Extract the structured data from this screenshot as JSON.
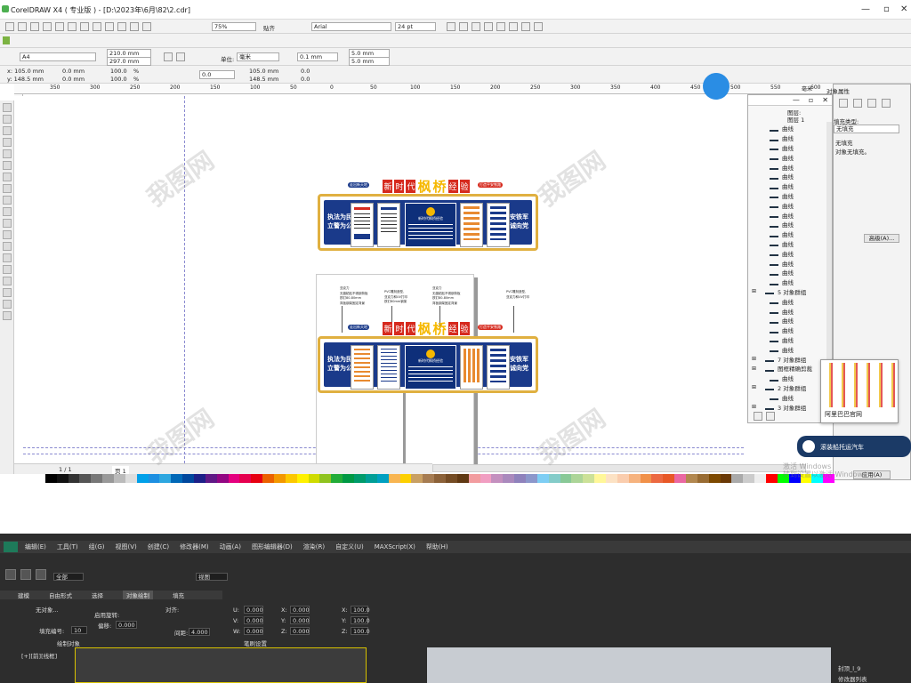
{
  "window": {
    "title": "CorelDRAW X4 ( 专业版 ) - [D:\\2023年\\6月\\82\\2.cdr]"
  },
  "toolbar1": {
    "zoom": "75%",
    "snap": "贴齐",
    "font": "Arial",
    "font_size": "24 pt"
  },
  "propbar": {
    "page_size": "A4",
    "width": "210.0 mm",
    "height": "297.0 mm",
    "unit_label": "单位:",
    "unit": "毫米",
    "nudge": "0.1 mm",
    "dup_x": "5.0 mm",
    "dup_y": "5.0 mm"
  },
  "objbar": {
    "x": "105.0 mm",
    "y": "148.5 mm",
    "w": "0.0 mm",
    "h": "0.0 mm",
    "sx": "100.0",
    "sy": "100.0",
    "pct": "%",
    "rot": "0.0",
    "cx": "105.0 mm",
    "cy": "148.5 mm",
    "o1": "0.0",
    "o2": "0.0"
  },
  "ruler": {
    "ticks": [
      "350",
      "300",
      "250",
      "200",
      "150",
      "100",
      "50",
      "0",
      "50",
      "100",
      "150",
      "200",
      "250",
      "300",
      "350",
      "400",
      "450",
      "500",
      "550",
      "600",
      "650"
    ],
    "unit": "毫米"
  },
  "board": {
    "title_parts": [
      "新",
      "时",
      "代",
      "枫",
      "桥",
      "经",
      "验"
    ],
    "left_text": [
      "执法为民",
      "立警为公"
    ],
    "right_text": [
      "公安铁军",
      "忠诚向党"
    ],
    "center_title": "新时代枫桥经验",
    "tag_left": "走出新天地",
    "tag_right": "打造平安铁路",
    "callouts": [
      "亚克力\n无缝粘贴不锈钢背板\n铁钉80-80mm\n背板钢架固定背景",
      "PVC雕刻造型,\n亚克力和UV打印\n铁钉80mm钢架",
      "亚克力\n无缝粘贴不锈钢背板\n铁钉80-80mm\n背板钢架固定背景",
      "PVC雕刻造型,\n亚克力和UV打印"
    ]
  },
  "objects_panel": {
    "layer1": "图层:",
    "layer2": "图层 1",
    "items": [
      {
        "label": "曲线"
      },
      {
        "label": "曲线"
      },
      {
        "label": "曲线"
      },
      {
        "label": "曲线"
      },
      {
        "label": "曲线"
      },
      {
        "label": "曲线"
      },
      {
        "label": "曲线"
      },
      {
        "label": "曲线"
      },
      {
        "label": "曲线"
      },
      {
        "label": "曲线"
      },
      {
        "label": "曲线"
      },
      {
        "label": "曲线"
      },
      {
        "label": "曲线"
      },
      {
        "label": "曲线"
      },
      {
        "label": "曲线"
      },
      {
        "label": "曲线"
      },
      {
        "label": "曲线"
      },
      {
        "label": "5 对象群组",
        "group": true
      },
      {
        "label": "曲线"
      },
      {
        "label": "曲线"
      },
      {
        "label": "曲线"
      },
      {
        "label": "曲线"
      },
      {
        "label": "曲线"
      },
      {
        "label": "曲线"
      },
      {
        "label": "7 对象群组",
        "group": true
      },
      {
        "label": "图框精确剪裁",
        "group": true
      },
      {
        "label": "曲线"
      },
      {
        "label": "2 对象群组",
        "group": true
      },
      {
        "label": "曲线"
      },
      {
        "label": "3 对象群组",
        "group": true
      }
    ]
  },
  "props_panel": {
    "title": "对象属性",
    "fill_type_label": "填充类型:",
    "fill_type": "无填充",
    "info1": "无填充",
    "info2": "对象无填充。",
    "advanced": "高级(A)...",
    "apply": "应用(A)"
  },
  "thumb_popup": {
    "caption": "阿里巴巴官网"
  },
  "chat_popup": {
    "text": "滚装船托运汽车"
  },
  "pages": {
    "nav": "1 / 1",
    "tab": "页 1"
  },
  "os_watermark": "激活 Windows\n转到设置以激活 Windows",
  "palette": [
    "#ffffff",
    "#000000",
    "#111",
    "#333",
    "#555",
    "#777",
    "#999",
    "#bbb",
    "#ddd",
    "#00a0e9",
    "#1d8fe1",
    "#2ea7e0",
    "#0068b7",
    "#00479d",
    "#1d2088",
    "#601986",
    "#920783",
    "#e4007f",
    "#e5004f",
    "#e60012",
    "#eb6100",
    "#f39800",
    "#fcc800",
    "#fff100",
    "#cfdb00",
    "#8fc31f",
    "#22ac38",
    "#009944",
    "#009b6b",
    "#009e96",
    "#00a0c1",
    "#f8b551",
    "#fdd000",
    "#c9a063",
    "#a67c52",
    "#8c6239",
    "#754c24",
    "#603913",
    "#f29c9f",
    "#f19ec2",
    "#c490bf",
    "#aa89bd",
    "#8f82bc",
    "#8c97cb",
    "#7ecef4",
    "#84ccc9",
    "#89c997",
    "#acd598",
    "#cce198",
    "#fff799",
    "#fce2c4",
    "#facdae",
    "#f6b37f",
    "#f19149",
    "#ec6941",
    "#e85827",
    "#ea68a2",
    "#b28850",
    "#996c33",
    "#7d4900",
    "#6a3906",
    "#aaaaaa",
    "#cccccc",
    "#eeeeee",
    "#ff0000",
    "#00ff00",
    "#0000ff",
    "#ffff00",
    "#00ffff",
    "#ff00ff"
  ],
  "max": {
    "menu": [
      "编辑(E)",
      "工具(T)",
      "组(G)",
      "视图(V)",
      "创建(C)",
      "修改器(M)",
      "动画(A)",
      "图形编辑器(D)",
      "渲染(R)",
      "自定义(U)",
      "MAXScript(X)",
      "帮助(H)"
    ],
    "tabs": [
      "建模",
      "自由形式",
      "选择",
      "对象绘制",
      "填充"
    ],
    "sel": "全部",
    "view": "视图",
    "brush_label": "无对象...",
    "fill_label": "填充编号:",
    "fill_val": "10",
    "apply_rot": "启用旋转:",
    "offset": "偏移:",
    "offset_val": "0.000",
    "align": "对齐:",
    "spacing": "间距:",
    "spacing_val": "4.000",
    "u": "0.000",
    "v": "0.000",
    "w": "0.000",
    "x": "0.000",
    "y": "0.000",
    "z": "0.000",
    "sx": "100.0",
    "sy": "100.0",
    "sz": "100.0",
    "footer_left": "绘制对象",
    "footer_right": "笔刷设置",
    "viewport_label": "[+][前][线框]",
    "obj_name": "封顶_l_9",
    "mod_list": "修改器列表"
  }
}
